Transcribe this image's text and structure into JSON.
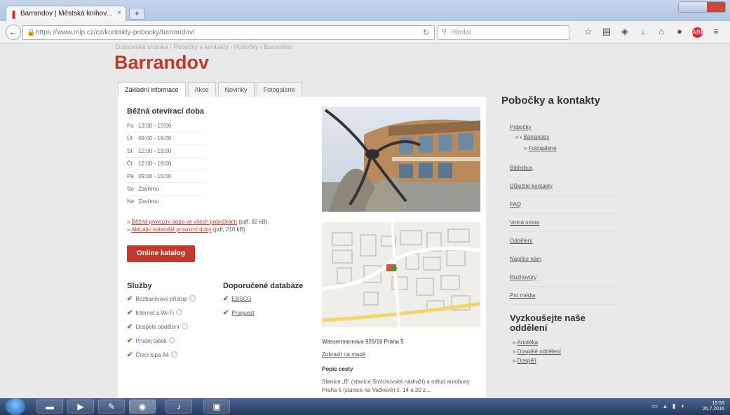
{
  "browser": {
    "tab_title": "Barrandov | Městská knihov...",
    "url": "https://www.mlp.cz/cz/kontakty-pobocky/barrandov/",
    "search_placeholder": "Hledat"
  },
  "page": {
    "title": "Barrandov",
    "breadcrumb": "Domovská stránka › Pobočky a kontakty › Pobočky › Barrandov",
    "tabs": [
      "Základní informace",
      "Akce",
      "Novinky",
      "Fotogalerie"
    ],
    "hours_title": "Běžná otevírací doba",
    "hours": [
      {
        "day": "Po",
        "time": "13:00 - 19:00"
      },
      {
        "day": "Út",
        "time": "09:00 - 19:00"
      },
      {
        "day": "St",
        "time": "12:00 - 19:00"
      },
      {
        "day": "Čt",
        "time": "12:00 - 19:00"
      },
      {
        "day": "Pá",
        "time": "09:00 - 15:00"
      },
      {
        "day": "So",
        "time": "Zavřeno"
      },
      {
        "day": "Ne",
        "time": "Zavřeno"
      }
    ],
    "file_links": [
      {
        "label": "Běžná provozní doba ve všech pobočkách",
        "meta": "(pdf, 92 kB)"
      },
      {
        "label": "Aktuální kalendář provozní doby",
        "meta": "(pdf, 210 kB)"
      }
    ],
    "catalog_button": "Online katalog",
    "services_title": "Služby",
    "services": [
      "Bezbariérový přístup",
      "Internet a Wi-Fi",
      "Dospělé oddělení",
      "Prodej tašek",
      "Čtecí lupa A4"
    ],
    "databases_title": "Doporučené databáze",
    "databases": [
      "EBSCO",
      "Proquest"
    ],
    "address": "Wassermannova 926/16 Praha 5",
    "map_link": "Zobrazit na mapě",
    "route_title": "Popis cesty",
    "route_desc": "Stanice „B“ (stanice Smíchovské nádraží) a odtud autobusy Praha 5 (stanice na Vačkově) č. 14 a 20 z..."
  },
  "sidebar": {
    "title": "Pobočky a kontakty",
    "items": [
      "Pobočky",
      "Barrandov",
      "Fotogalerie",
      "Bibliobus",
      "Důležité kontakty",
      "FAQ",
      "Volná místa",
      "Oddělení",
      "Napište nám",
      "Rozhovory",
      "Pro média"
    ],
    "title2": "Vyzkoušejte naše oddělení",
    "items2": [
      "Artotéka",
      "Dospělé oddělení",
      "Dospělí"
    ]
  },
  "taskbar": {
    "time": "15:53",
    "date": "26.7.2016"
  },
  "colors": {
    "accent": "#c0392b",
    "check": "#3a9a2a"
  }
}
